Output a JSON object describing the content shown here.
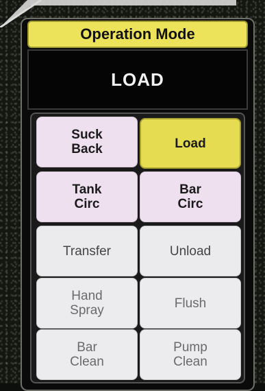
{
  "colors": {
    "header_yellow": "#ece35a",
    "selected_yellow": "#e6dc52",
    "pink_button": "#eee0ef",
    "gray_button": "#ebebed",
    "panel_black": "#050505"
  },
  "header": {
    "title": "Operation Mode"
  },
  "current_mode": {
    "value": "LOAD"
  },
  "buttons": [
    {
      "label": "Suck\nBack",
      "style": "pink"
    },
    {
      "label": "Load",
      "style": "selected"
    },
    {
      "label": "Tank\nCirc",
      "style": "pink"
    },
    {
      "label": "Bar\nCirc",
      "style": "pink"
    },
    {
      "label": "Transfer",
      "style": "gray"
    },
    {
      "label": "Unload",
      "style": "gray"
    },
    {
      "label": "Hand\nSpray",
      "style": "dim"
    },
    {
      "label": "Flush",
      "style": "dim"
    },
    {
      "label": "Bar\nClean",
      "style": "dim"
    },
    {
      "label": "Pump\nClean",
      "style": "dim"
    }
  ]
}
